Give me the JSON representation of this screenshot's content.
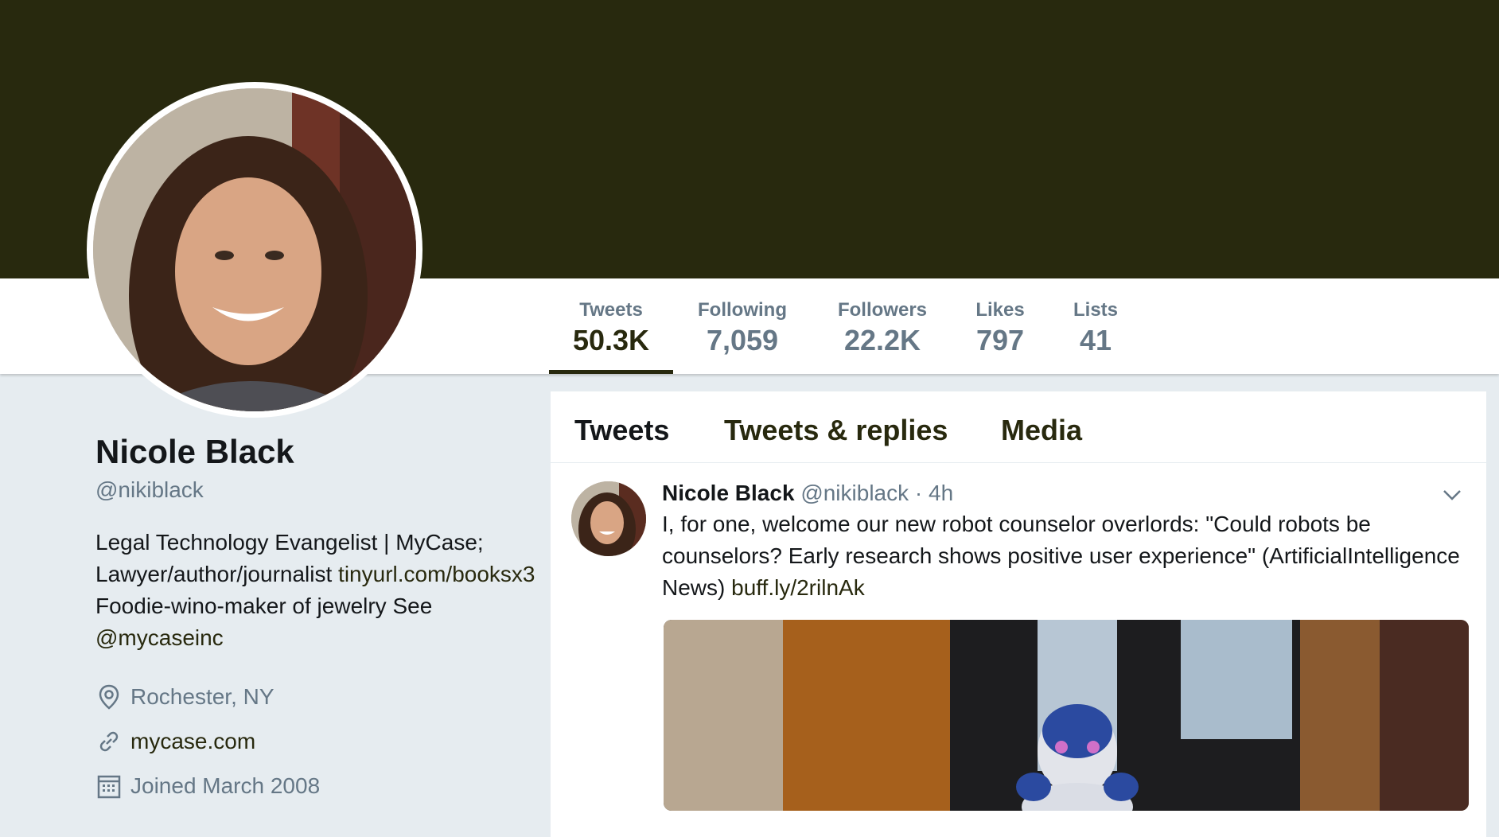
{
  "profile": {
    "name": "Nicole Black",
    "handle": "@nikiblack",
    "bio_part1": "Legal Technology Evangelist | MyCase; Lawyer/author/journalist ",
    "bio_link1": "tinyurl.com/booksx3",
    "bio_part2": " Foodie-wino-maker of jewelry See ",
    "bio_link2": "@mycaseinc",
    "location": "Rochester, NY",
    "website": "mycase.com",
    "joined": "Joined March 2008"
  },
  "stats": [
    {
      "label": "Tweets",
      "value": "50.3K"
    },
    {
      "label": "Following",
      "value": "7,059"
    },
    {
      "label": "Followers",
      "value": "22.2K"
    },
    {
      "label": "Likes",
      "value": "797"
    },
    {
      "label": "Lists",
      "value": "41"
    }
  ],
  "timeline_tabs": [
    "Tweets",
    "Tweets & replies",
    "Media"
  ],
  "tweet": {
    "name": "Nicole Black",
    "handle": "@nikiblack",
    "separator": "·",
    "time": "4h",
    "text": "I, for one, welcome our new robot counselor overlords: \"Could robots be counselors? Early research shows positive user experience\" (ArtificialIntelligence News) ",
    "link": "buff.ly/2rilnAk"
  },
  "colors": {
    "banner": "#28290e",
    "link": "#28290e",
    "muted": "#657786",
    "text": "#14171a",
    "page_bg": "#e6ecf0"
  },
  "icons": [
    "location-pin-icon",
    "link-icon",
    "calendar-icon",
    "chevron-down-icon"
  ]
}
